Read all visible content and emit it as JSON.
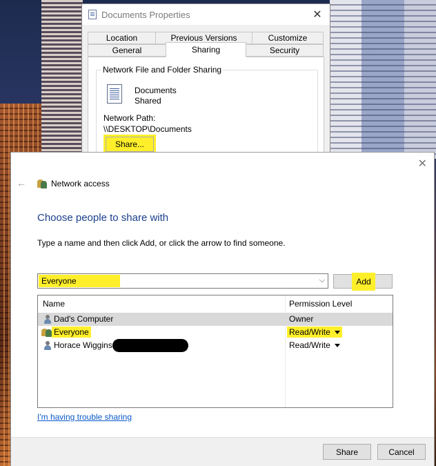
{
  "properties_window": {
    "title": "Documents Properties",
    "tabs_row1": [
      "Location",
      "Previous Versions",
      "Customize"
    ],
    "tabs_row2": [
      "General",
      "Sharing",
      "Security"
    ],
    "active_tab": "Sharing",
    "group_title": "Network File and Folder Sharing",
    "folder_name": "Documents",
    "folder_state": "Shared",
    "network_path_label": "Network Path:",
    "network_path": "\\\\DESKTOP\\Documents",
    "share_button": "Share..."
  },
  "network_access": {
    "title": "Network access",
    "heading": "Choose people to share with",
    "instructions": "Type a name and then click Add, or click the arrow to find someone.",
    "input_value": "Everyone",
    "add_button": "Add",
    "columns": {
      "name": "Name",
      "permission": "Permission Level"
    },
    "rows": [
      {
        "name": "Dad's Computer",
        "permission": "Owner"
      },
      {
        "name": "Everyone",
        "permission": "Read/Write"
      },
      {
        "name": "Horace Wiggins",
        "permission": "Read/Write"
      }
    ],
    "trouble_link": "I'm having trouble sharing",
    "share_button": "Share",
    "cancel_button": "Cancel"
  },
  "icons": {
    "close": "✕",
    "back": "←",
    "dropdown": "⌵"
  },
  "colors": {
    "highlight": "#ffef2a",
    "heading": "#1a3e8a",
    "link": "#0a58c8"
  }
}
